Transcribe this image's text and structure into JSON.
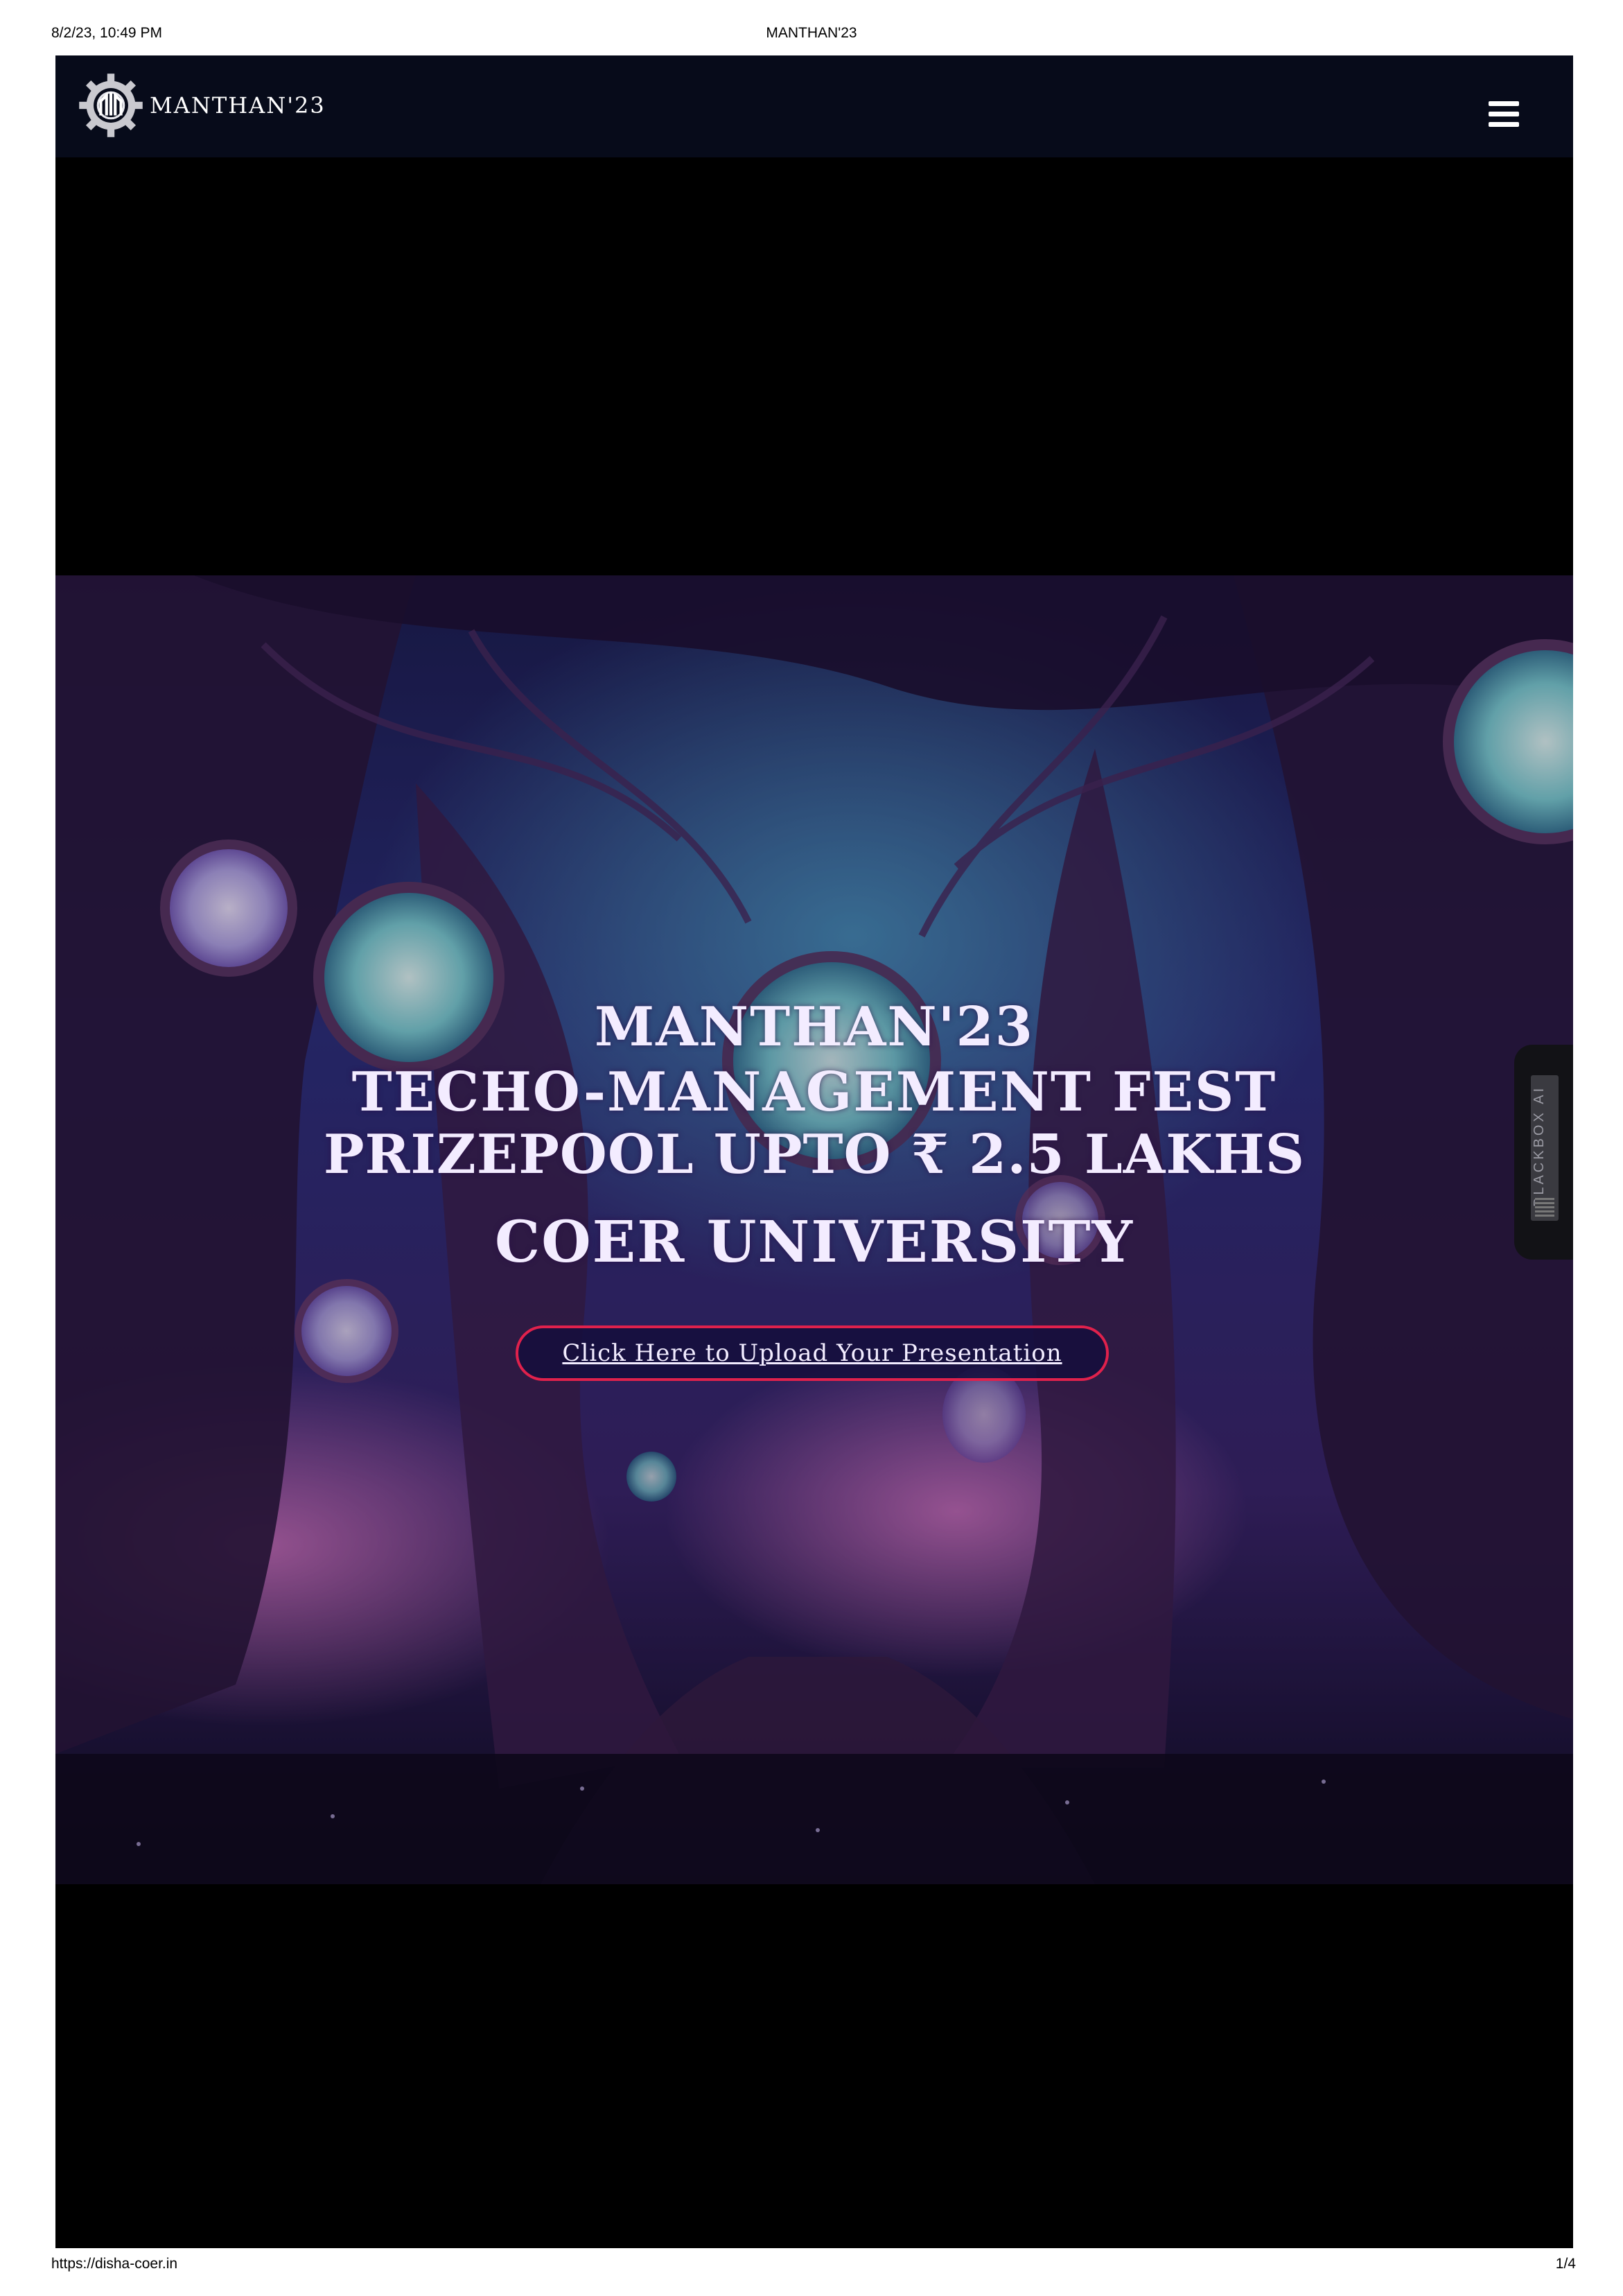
{
  "print_header": {
    "datetime": "8/2/23, 10:49 PM",
    "title": "MANTHAN'23"
  },
  "print_footer": {
    "url": "https://disha-coer.in",
    "page": "1/4"
  },
  "navbar": {
    "logo_text": "MANTHAN'23",
    "menu_icon": "hamburger-menu-icon"
  },
  "hero": {
    "line1": "MANTHAN'23",
    "line2": "TECHO-MANAGEMENT FEST",
    "line3": "PRIZEPOOL UPTO ₹ 2.5 LAKHS",
    "line4": "COER UNIVERSITY",
    "cta_label": "Click Here to Upload Your Presentation"
  },
  "side_widget": {
    "label": "BLACKBOX AI"
  },
  "colors": {
    "navbar_bg": "#070b1a",
    "cta_border": "#e0214c",
    "hero_text": "#f3ecff"
  }
}
